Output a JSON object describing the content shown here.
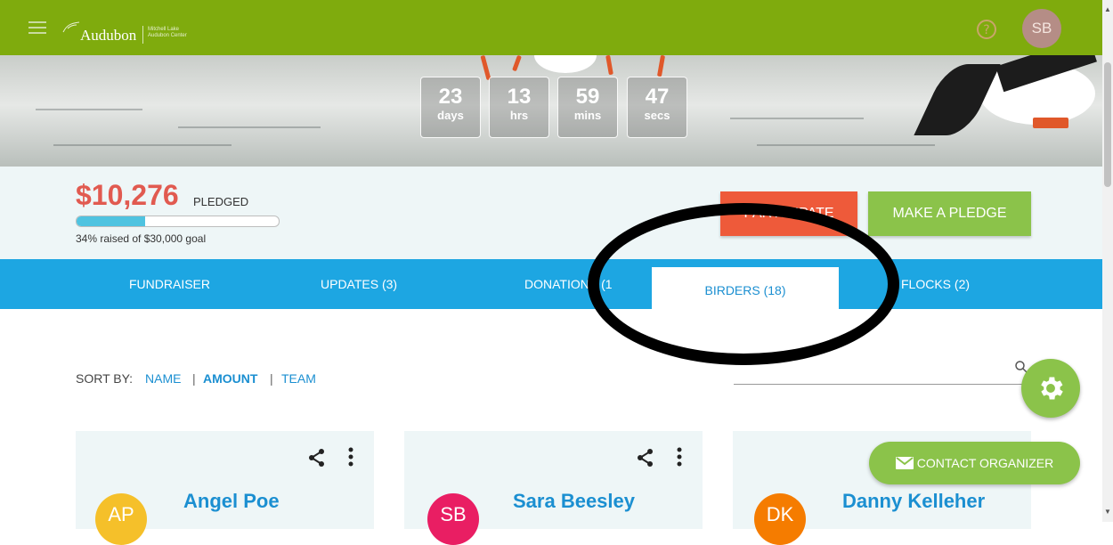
{
  "header": {
    "brand": "Audubon",
    "brand_sub_line1": "Mitchell Lake",
    "brand_sub_line2": "Audubon Center",
    "user_initials": "SB",
    "accent_color": "#7fab0d"
  },
  "countdown": [
    {
      "value": "23",
      "unit": "days"
    },
    {
      "value": "13",
      "unit": "hrs"
    },
    {
      "value": "59",
      "unit": "mins"
    },
    {
      "value": "47",
      "unit": "secs"
    }
  ],
  "pledge": {
    "amount": "$10,276",
    "label": "PLEDGED",
    "progress_fraction": 0.34,
    "goal_text": "34% raised of $30,000 goal",
    "participate_label": "PARTICIPATE",
    "pledge_label": "MAKE A PLEDGE"
  },
  "nav": {
    "tabs": [
      {
        "label": "FUNDRAISER"
      },
      {
        "label": "UPDATES (3)"
      },
      {
        "label": "DONATIONS (1"
      },
      {
        "label": "BIRDERS (18)"
      },
      {
        "label": "FLOCKS (2)"
      }
    ],
    "active_index": 3
  },
  "sort": {
    "label": "SORT BY:",
    "options": [
      "NAME",
      "AMOUNT",
      "TEAM"
    ],
    "active": "AMOUNT",
    "separator": "|"
  },
  "cards": [
    {
      "initials": "AP",
      "name": "Angel Poe",
      "avatar_color": "#f5c02a"
    },
    {
      "initials": "SB",
      "name": "Sara Beesley",
      "avatar_color": "#e91e63"
    },
    {
      "initials": "DK",
      "name": "Danny Kelleher",
      "avatar_color": "#f57c00"
    }
  ],
  "contact_button": "CONTACT ORGANIZER",
  "icons": [
    "menu-icon",
    "bird-logo-icon",
    "help-icon",
    "search-icon",
    "gear-icon",
    "share-icon",
    "more-vert-icon",
    "mail-icon"
  ]
}
